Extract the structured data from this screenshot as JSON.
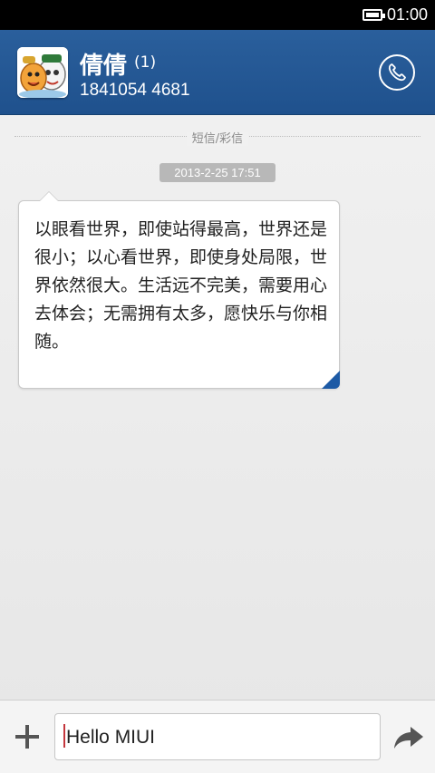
{
  "status_bar": {
    "time": "01:00"
  },
  "header": {
    "contact_name": "倩倩",
    "unread_count": "(1)",
    "phone_number": "1841054 4681"
  },
  "conversation": {
    "section_label": "短信/彩信",
    "timestamp": "2013-2-25 17:51",
    "messages": [
      {
        "text": "以眼看世界，即使站得最高，世界还是很小；以心看世界，即使身处局限，世界依然很大。生活远不完美，需要用心去体会；无需拥有太多，愿快乐与你相随。"
      }
    ]
  },
  "composer": {
    "input_value": "Hello MIUI"
  },
  "colors": {
    "header_blue": "#245894",
    "accent_blue": "#1d5aa5",
    "caret_red": "#c4373d"
  },
  "icons": {
    "battery": "battery-icon",
    "call": "phone-icon",
    "add": "plus-icon",
    "send": "send-arrow-icon"
  }
}
